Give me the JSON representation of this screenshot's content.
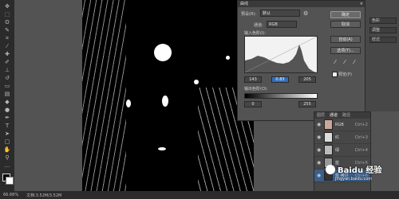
{
  "toolbar": {
    "tools": [
      "move-icon",
      "marquee-icon",
      "lasso-icon",
      "quick-select-icon",
      "crop-icon",
      "eyedropper-icon",
      "healing-icon",
      "brush-icon",
      "stamp-icon",
      "history-brush-icon",
      "eraser-icon",
      "gradient-icon",
      "blur-icon",
      "dodge-icon",
      "pen-icon",
      "type-icon",
      "path-select-icon",
      "shape-icon",
      "hand-icon",
      "zoom-icon",
      "more-icon"
    ]
  },
  "statusbar": {
    "zoom": "66.66%",
    "doc": "文档:3.52M/3.52M"
  },
  "dialog": {
    "title": "曲线",
    "preset_label": "预设(R):",
    "preset_value": "默认",
    "channel_label": "通道:",
    "channel_value": "RGB",
    "input_levels_label": "输入色阶(I):",
    "input_values": [
      "143",
      "0.83",
      "205"
    ],
    "output_levels_label": "输出色阶(O):",
    "output_values": [
      "0",
      "255"
    ],
    "preview_label": "预览(P)",
    "buttons": {
      "ok": "确定",
      "cancel": "取消",
      "auto": "自动(A)",
      "options": "选项(T)..."
    }
  },
  "channels_panel": {
    "tabs": [
      "图层",
      "通道",
      "路径"
    ],
    "rows": [
      {
        "name": "RGB",
        "key": "Ctrl+2"
      },
      {
        "name": "红",
        "key": "Ctrl+3"
      },
      {
        "name": "绿",
        "key": "Ctrl+4"
      },
      {
        "name": "蓝",
        "key": "Ctrl+5"
      },
      {
        "name": "蓝 拷贝",
        "key": "Ctrl+6"
      }
    ]
  },
  "right_panel": {
    "items": [
      "色彩",
      "调整",
      "样式"
    ]
  },
  "watermark": {
    "text": "jingyan.baidu.com",
    "brand": "Baidu 经验"
  }
}
